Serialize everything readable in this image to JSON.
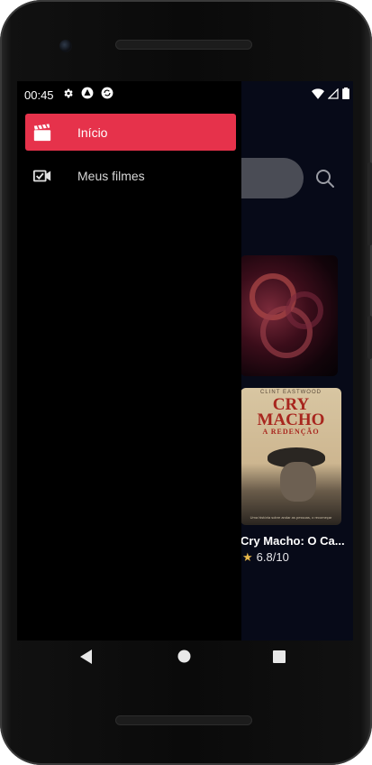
{
  "status_bar": {
    "time": "00:45",
    "left_icons": [
      "gear-icon",
      "expo-icon",
      "sync-icon"
    ],
    "right_icons": [
      "wifi-icon",
      "signal-icon",
      "battery-icon"
    ]
  },
  "drawer": {
    "items": [
      {
        "label": "Início",
        "icon": "clapperboard-icon",
        "active": true
      },
      {
        "label": "Meus filmes",
        "icon": "video-check-icon",
        "active": false
      }
    ],
    "accent_color": "#e6324b"
  },
  "background_app": {
    "movie": {
      "title": "Cry Macho: O Ca...",
      "rating": "6.8/10",
      "poster": {
        "credit": "CLINT EASTWOOD",
        "title_line1": "CRY",
        "title_line2": "MACHO",
        "subtitle": "A REDENÇÃO",
        "tagline": "Uma história sobre andar as pessoas, o recomeçar"
      }
    }
  },
  "nav_bar": {
    "buttons": [
      "back-icon",
      "home-icon",
      "recents-icon"
    ]
  }
}
